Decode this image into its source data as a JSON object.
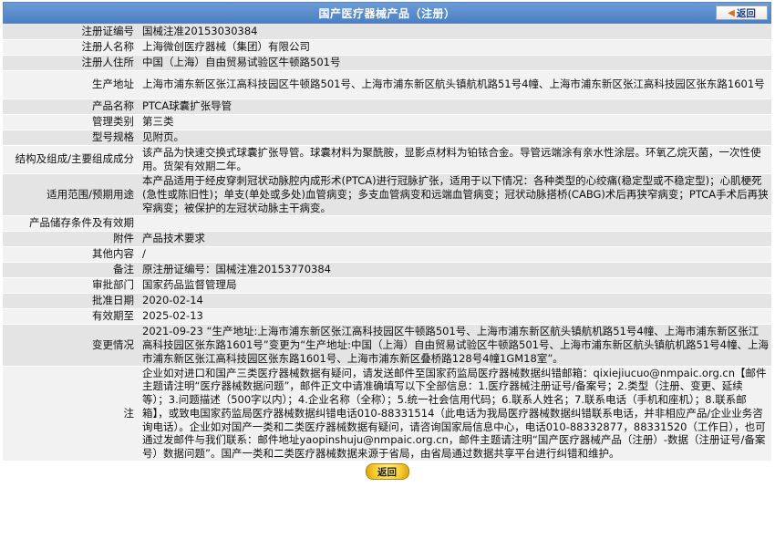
{
  "header": {
    "title": "国产医疗器械产品（注册）",
    "back_label": "返回"
  },
  "fields": [
    {
      "label": "注册证编号",
      "value": "国械注准20153030384"
    },
    {
      "label": "注册人名称",
      "value": "上海微创医疗器械（集团）有限公司"
    },
    {
      "label": "注册人住所",
      "value": "中国（上海）自由贸易试验区牛顿路501号"
    },
    {
      "label": "生产地址",
      "value": "上海市浦东新区张江高科技园区牛顿路501号、上海市浦东新区航头镇航机路51号4幢、上海市浦东新区张江高科技园区张东路1601号"
    },
    {
      "label": "产品名称",
      "value": "PTCA球囊扩张导管"
    },
    {
      "label": "管理类别",
      "value": "第三类"
    },
    {
      "label": "型号规格",
      "value": "见附页。"
    },
    {
      "label": "结构及组成/主要组成成分",
      "value": "该产品为快速交换式球囊扩张导管。球囊材料为聚酰胺，显影点材料为铂铱合金。导管远端涂有亲水性涂层。环氧乙烷灭菌，一次性使用。货架有效期二年。"
    },
    {
      "label": "适用范围/预期用途",
      "value": "本产品适用于经皮穿刺冠状动脉腔内成形术(PTCA)进行冠脉扩张，适用于以下情况：各种类型的心绞痛(稳定型或不稳定型)；心肌梗死(急性或陈旧性)；单支(单处或多处)血管病变；多支血管病变和远端血管病变；冠状动脉搭桥(CABG)术后再狭窄病变；PTCA手术后再狭窄病变；被保护的左冠状动脉主干病变。"
    },
    {
      "label": "产品储存条件及有效期",
      "value": ""
    },
    {
      "label": "附件",
      "value": "产品技术要求"
    },
    {
      "label": "其他内容",
      "value": "/"
    },
    {
      "label": "备注",
      "value": "原注册证编号：国械注准20153770384"
    },
    {
      "label": "审批部门",
      "value": "国家药品监督管理局"
    },
    {
      "label": "批准日期",
      "value": "2020-02-14"
    },
    {
      "label": "有效期至",
      "value": "2025-02-13"
    },
    {
      "label": "变更情况",
      "value": "2021-09-23 “生产地址:上海市浦东新区张江高科技园区牛顿路501号、上海市浦东新区航头镇航机路51号4幢、上海市浦东新区张江高科技园区张东路1601号”变更为“生产地址:中国（上海）自由贸易试验区牛顿路501号、上海市浦东新区航头镇航机路51号4幢、上海市浦东新区张江高科技园区张东路1601号、上海市浦东新区叠桥路128号4幢1GM18室”。"
    },
    {
      "label": "注",
      "value": "企业如对进口和国产三类医疗器械数据有疑问，请发送邮件至国家药监局医疗器械数据纠错邮箱：qixiejiucuo@nmpaic.org.cn【邮件主题请注明“医疗器械数据问题”，邮件正文中请准确填写以下全部信息：1.医疗器械注册证号/备案号；2.类型（注册、变更、延续等）；3.问题描述（500字以内）；4.企业名称（全称）；5.统一社会信用代码；6.联系人姓名；7.联系电话（手机和座机）；8.联系邮箱】，或致电国家药监局医疗器械数据纠错电话010-88331514（此电话为我局医疗器械数据纠错联系电话，并非相应产品/企业业务咨询电话）。企业如对国产一类和二类医疗器械数据有疑问，请咨询国家局信息中心，电话010-88332877，88331520（工作日），也可通过发邮件与我们联系：邮件地址yaopinshuju@nmpaic.org.cn，邮件主题请注明“国产医疗器械产品（注册）-数据（注册证号/备案号）数据问题”。国产一类和二类医疗器械数据来源于省局，由省局通过数据共享平台进行纠错和维护。"
    }
  ],
  "footer": {
    "back_label": "返回"
  }
}
